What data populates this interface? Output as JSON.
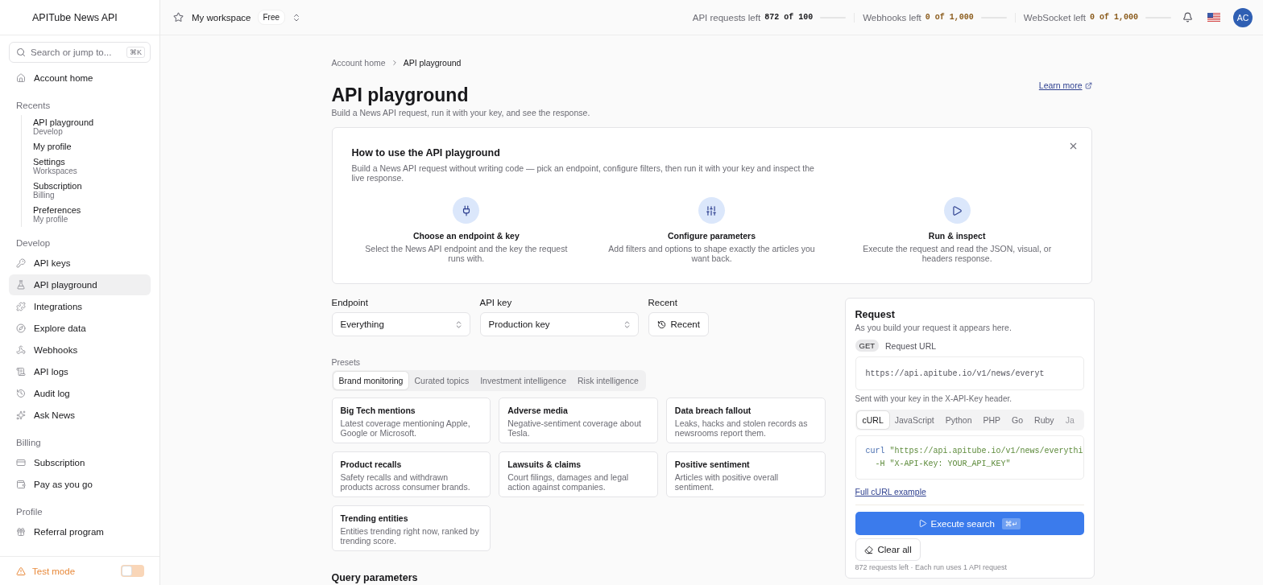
{
  "sidebar": {
    "brand": "APITube News API",
    "search": {
      "placeholder": "Search or jump to...",
      "shortcut": "⌘K"
    },
    "home": {
      "label": "Account home",
      "selected": false
    },
    "recents": {
      "title": "Recents",
      "items": [
        {
          "label": "API playground",
          "sublabel": "Develop"
        },
        {
          "label": "My profile"
        },
        {
          "label": "Settings",
          "sublabel": "Workspaces"
        },
        {
          "label": "Subscription",
          "sublabel": "Billing"
        },
        {
          "label": "Preferences",
          "sublabel": "My profile"
        }
      ]
    },
    "sections": [
      {
        "title": "Develop",
        "items": [
          {
            "label": "API keys",
            "selected": false
          },
          {
            "label": "API playground",
            "selected": true
          },
          {
            "label": "Integrations",
            "selected": false
          },
          {
            "label": "Explore data",
            "selected": false
          },
          {
            "label": "Webhooks",
            "selected": false
          },
          {
            "label": "API logs",
            "selected": false
          },
          {
            "label": "Audit log",
            "selected": false
          },
          {
            "label": "Ask News",
            "selected": false
          }
        ]
      },
      {
        "title": "Billing",
        "items": [
          {
            "label": "Subscription",
            "selected": false
          },
          {
            "label": "Pay as you go",
            "selected": false
          }
        ]
      },
      {
        "title": "Profile",
        "items": [
          {
            "label": "Referral program",
            "selected": false
          }
        ]
      }
    ],
    "test_mode": {
      "label": "Test mode",
      "on": false
    }
  },
  "topbar": {
    "workspace": "My workspace",
    "plan": "Free",
    "meters": [
      {
        "label": "API requests left",
        "value": "872 of 100",
        "warning": false,
        "level": 0
      },
      {
        "label": "Webhooks left",
        "value": "0 of 1,000",
        "warning": true,
        "level": 0
      },
      {
        "label": "WebSocket left",
        "value": "0 of 1,000",
        "warning": true,
        "level": 0
      }
    ],
    "avatar": "AC"
  },
  "breadcrumb": [
    "Account home",
    "API playground"
  ],
  "page": {
    "title": "API playground",
    "subtitle": "Build a News API request, run it with your key, and see the response.",
    "learn_more": "Learn more"
  },
  "howto": {
    "title": "How to use the API playground",
    "text": "Build a News API request without writing code — pick an endpoint, configure filters, then run it with your key and inspect the live response.",
    "steps": [
      {
        "title": "Choose an endpoint & key",
        "text": "Select the News API endpoint and the key the request runs with."
      },
      {
        "title": "Configure parameters",
        "text": "Add filters and options to shape exactly the articles you want back."
      },
      {
        "title": "Run & inspect",
        "text": "Execute the request and read the JSON, visual, or headers response."
      }
    ]
  },
  "form": {
    "endpoint": {
      "label": "Endpoint",
      "value": "Everything"
    },
    "api_key": {
      "label": "API key",
      "value": "Production key"
    },
    "recent": {
      "label": "Recent",
      "button": "Recent"
    }
  },
  "presets": {
    "label": "Presets",
    "tabs": [
      {
        "label": "Brand monitoring",
        "selected": true
      },
      {
        "label": "Curated topics",
        "selected": false
      },
      {
        "label": "Investment intelligence",
        "selected": false
      },
      {
        "label": "Risk intelligence",
        "selected": false
      }
    ],
    "cards": [
      {
        "title": "Big Tech mentions",
        "text": "Latest coverage mentioning Apple, Google or Microsoft."
      },
      {
        "title": "Adverse media",
        "text": "Negative-sentiment coverage about Tesla."
      },
      {
        "title": "Data breach fallout",
        "text": "Leaks, hacks and stolen records as newsrooms report them."
      },
      {
        "title": "Product recalls",
        "text": "Safety recalls and withdrawn products across consumer brands."
      },
      {
        "title": "Lawsuits & claims",
        "text": "Court filings, damages and legal action against companies."
      },
      {
        "title": "Positive sentiment",
        "text": "Articles with positive overall sentiment."
      },
      {
        "title": "Trending entities",
        "text": "Entities trending right now, ranked by trending score."
      }
    ]
  },
  "query_parameters": {
    "title": "Query parameters"
  },
  "request": {
    "title": "Request",
    "subtitle": "As you build your request it appears here.",
    "method": "GET",
    "url_label": "Request URL",
    "url": "https://api.apitube.io/v1/news/everyt",
    "url_note": "Sent with your key in the X-API-Key header.",
    "languages": [
      {
        "label": "cURL",
        "selected": true
      },
      {
        "label": "JavaScript",
        "selected": false
      },
      {
        "label": "Python",
        "selected": false
      },
      {
        "label": "PHP",
        "selected": false
      },
      {
        "label": "Go",
        "selected": false
      },
      {
        "label": "Ruby",
        "selected": false
      },
      {
        "label": "Ja",
        "selected": false
      }
    ],
    "code": [
      [
        {
          "kind": "command",
          "text": "curl"
        },
        {
          "kind": "string",
          "text": "\"https://api.apitube.io/v1/news/everythi"
        }
      ],
      [
        {
          "kind": "string",
          "text": "  -H \"X-API-Key: YOUR_API_KEY\""
        }
      ]
    ],
    "example_link": "Full cURL example",
    "execute": "Execute search",
    "execute_shortcut": "⌘↵",
    "clear": "Clear all",
    "footer": "872 requests left · Each run uses 1 API request"
  }
}
